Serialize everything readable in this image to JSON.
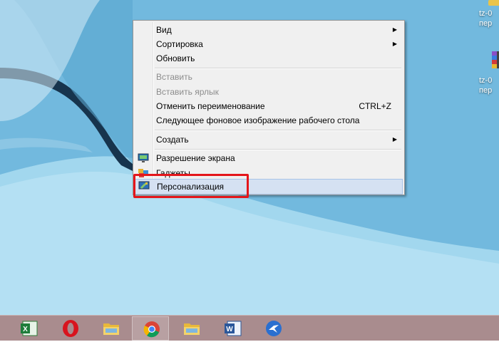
{
  "context_menu": {
    "items": [
      {
        "label": "Вид",
        "submenu": true
      },
      {
        "label": "Сортировка",
        "submenu": true
      },
      {
        "label": "Обновить"
      },
      {
        "label": "Вставить",
        "disabled": true
      },
      {
        "label": "Вставить ярлык",
        "disabled": true
      },
      {
        "label": "Отменить переименование",
        "shortcut": "CTRL+Z"
      },
      {
        "label": "Следующее фоновое изображение рабочего стола"
      },
      {
        "label": "Создать",
        "submenu": true
      },
      {
        "label": "Разрешение экрана",
        "icon": "screen-resolution-icon"
      },
      {
        "label": "Гаджеты",
        "icon": "gadgets-icon"
      },
      {
        "label": "Персонализация",
        "icon": "personalization-icon",
        "highlighted": true
      }
    ],
    "highlight_color": "#e4161b"
  },
  "desktop_icons": [
    {
      "label_line1": "tz-0",
      "label_line2": "пер",
      "icon": "file-icon"
    },
    {
      "label_line1": "tz-0",
      "label_line2": "пер",
      "icon": "winrar-archive-icon"
    }
  ],
  "taskbar": {
    "apps": [
      {
        "name": "excel",
        "icon": "excel-icon"
      },
      {
        "name": "opera",
        "icon": "opera-icon"
      },
      {
        "name": "explorer",
        "icon": "folder-icon"
      },
      {
        "name": "chrome",
        "icon": "chrome-icon",
        "active": true
      },
      {
        "name": "explorer-2",
        "icon": "folder-icon"
      },
      {
        "name": "word",
        "icon": "word-icon"
      },
      {
        "name": "app",
        "icon": "bird-app-icon"
      }
    ],
    "color": "#a98c8e"
  },
  "colors": {
    "desktop_bg": "#6fb6dc",
    "menu_bg": "#f0f0f0",
    "hover_bg": "#d5e1f2"
  }
}
